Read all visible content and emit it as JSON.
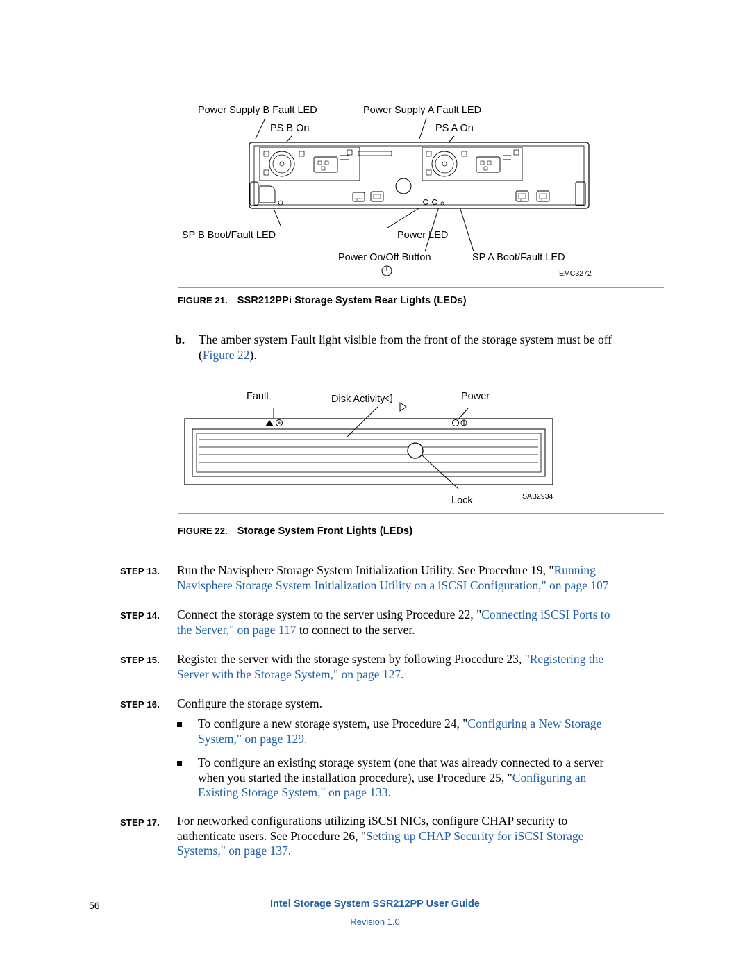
{
  "figure21": {
    "labels": {
      "ps_b_fault": "Power Supply B Fault LED",
      "ps_a_fault": "Power Supply A Fault LED",
      "ps_b_on": "PS B On",
      "ps_a_on": "PS A On",
      "sp_b_boot": "SP B Boot/Fault LED",
      "power_led": "Power LED",
      "power_button": "Power On/Off Button",
      "sp_a_boot": "SP A Boot/Fault LED",
      "art_code": "EMC3272"
    },
    "caption_num": "FIGURE 21.",
    "caption_title": "SSR212PPi Storage System Rear Lights (LEDs)"
  },
  "step_b": {
    "tag": "b.",
    "text_1": "The amber system Fault light visible from the front of the storage system must be off",
    "text_2_link": "Figure 22",
    "text_2_pre": "(",
    "text_2_post": ")."
  },
  "figure22": {
    "labels": {
      "fault": "Fault",
      "disk_activity": "Disk Activity",
      "power": "Power",
      "lock": "Lock",
      "art_code": "SAB2934"
    },
    "caption_num": "FIGURE 22.",
    "caption_title": "Storage System Front Lights (LEDs)"
  },
  "steps": [
    {
      "tag": "STEP 13.",
      "line1_black": "Run the Navisphere Storage System Initialization Utility. See Procedure 19, \"",
      "line1_blue": "Running",
      "line2_blue": "Navisphere Storage System Initialization Utility on a iSCSI Configuration,\" on page",
      "line2_blue_tail": " 107"
    },
    {
      "tag": "STEP 14.",
      "line1_black": "Connect the storage system to the server using Procedure 22, \"",
      "line1_blue": "Connecting iSCSI Ports to",
      "line2_blue": "the Server,\" on page 117",
      "line2_black": " to connect to the server."
    },
    {
      "tag": "STEP 15.",
      "line1_black": "Register the server with the storage system by following Procedure 23, \"",
      "line1_blue": "Registering the",
      "line2_blue": "Server with the Storage System,\" on page 127."
    },
    {
      "tag": "STEP 16.",
      "line1_black": "Configure the storage system."
    },
    {
      "tag": "STEP 17.",
      "line1_black": "For networked configurations utilizing iSCSI NICs, configure CHAP security to",
      "line2_black": "authenticate users. See Procedure 26, \"",
      "line2_blue": "Setting up CHAP Security for iSCSI Storage",
      "line3_blue": "Systems,\" on page 137."
    }
  ],
  "bullets": [
    {
      "line1_black": "To configure a new storage system, use Procedure 24, \"",
      "line1_blue": "Configuring a New Storage",
      "line2_blue": "System,\" on page 129."
    },
    {
      "line1_black": "To configure an existing storage system (one that was already connected to a server",
      "line2_black": "when you started the installation procedure), use Procedure 25, \"",
      "line2_blue": "Configuring an",
      "line3_blue": "Existing Storage System,\" on page 133."
    }
  ],
  "footer": {
    "page_number": "56",
    "guide_title": "Intel Storage System SSR212PP User Guide",
    "revision": "Revision 1.0"
  }
}
